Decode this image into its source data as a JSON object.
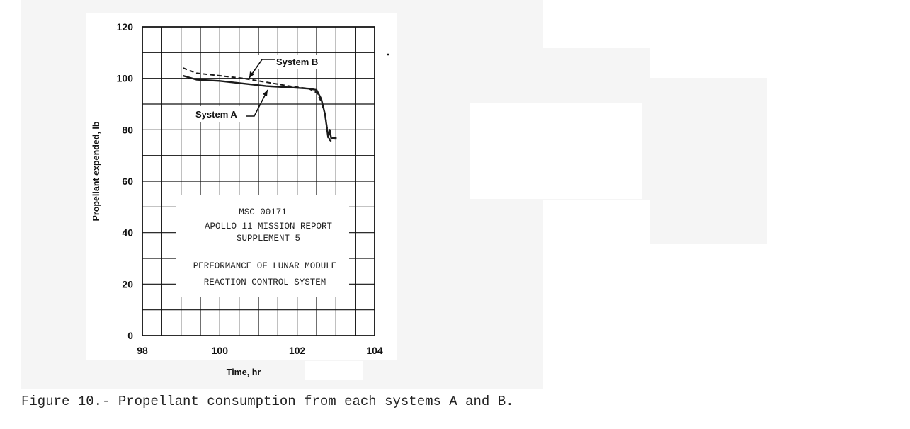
{
  "chart_data": {
    "type": "line",
    "xlabel": "Time, hr",
    "ylabel": "Propellant expended, lb",
    "xlim": [
      98,
      104
    ],
    "ylim": [
      0,
      120
    ],
    "xticks": [
      98,
      100,
      102,
      104
    ],
    "yticks": [
      0,
      20,
      40,
      60,
      80,
      100,
      120
    ],
    "grid": true,
    "series": [
      {
        "name": "System A",
        "style": "solid",
        "x": [
          99.05,
          99.4,
          100.0,
          100.6,
          101.2,
          101.8,
          102.3,
          102.5,
          102.62,
          102.72,
          102.8,
          102.84,
          102.88,
          102.95,
          103.02
        ],
        "y": [
          101,
          99.5,
          99,
          98,
          97,
          96.5,
          96,
          95.5,
          92,
          86,
          77,
          80,
          76.5,
          77,
          77
        ]
      },
      {
        "name": "System B",
        "style": "dashed",
        "x": [
          99.05,
          99.4,
          100.0,
          100.6,
          101.2,
          101.8,
          102.3,
          102.5,
          102.62,
          102.72,
          102.8,
          102.84,
          102.88,
          102.95,
          103.02
        ],
        "y": [
          104,
          102,
          101,
          100,
          98.5,
          97,
          96,
          94.5,
          91,
          86,
          78,
          76,
          75.5,
          76.5,
          76.5
        ]
      }
    ],
    "annotations": [
      "System B",
      "System A"
    ]
  },
  "stamp": {
    "doc_number": "MSC-00171",
    "report_title": "APOLLO 11 MISSION REPORT",
    "supplement": "SUPPLEMENT 5",
    "subject_line1": "PERFORMANCE OF LUNAR MODULE",
    "subject_line2": "REACTION CONTROL SYSTEM"
  },
  "caption": "Figure 10.- Propellant consumption from each systems A and B."
}
